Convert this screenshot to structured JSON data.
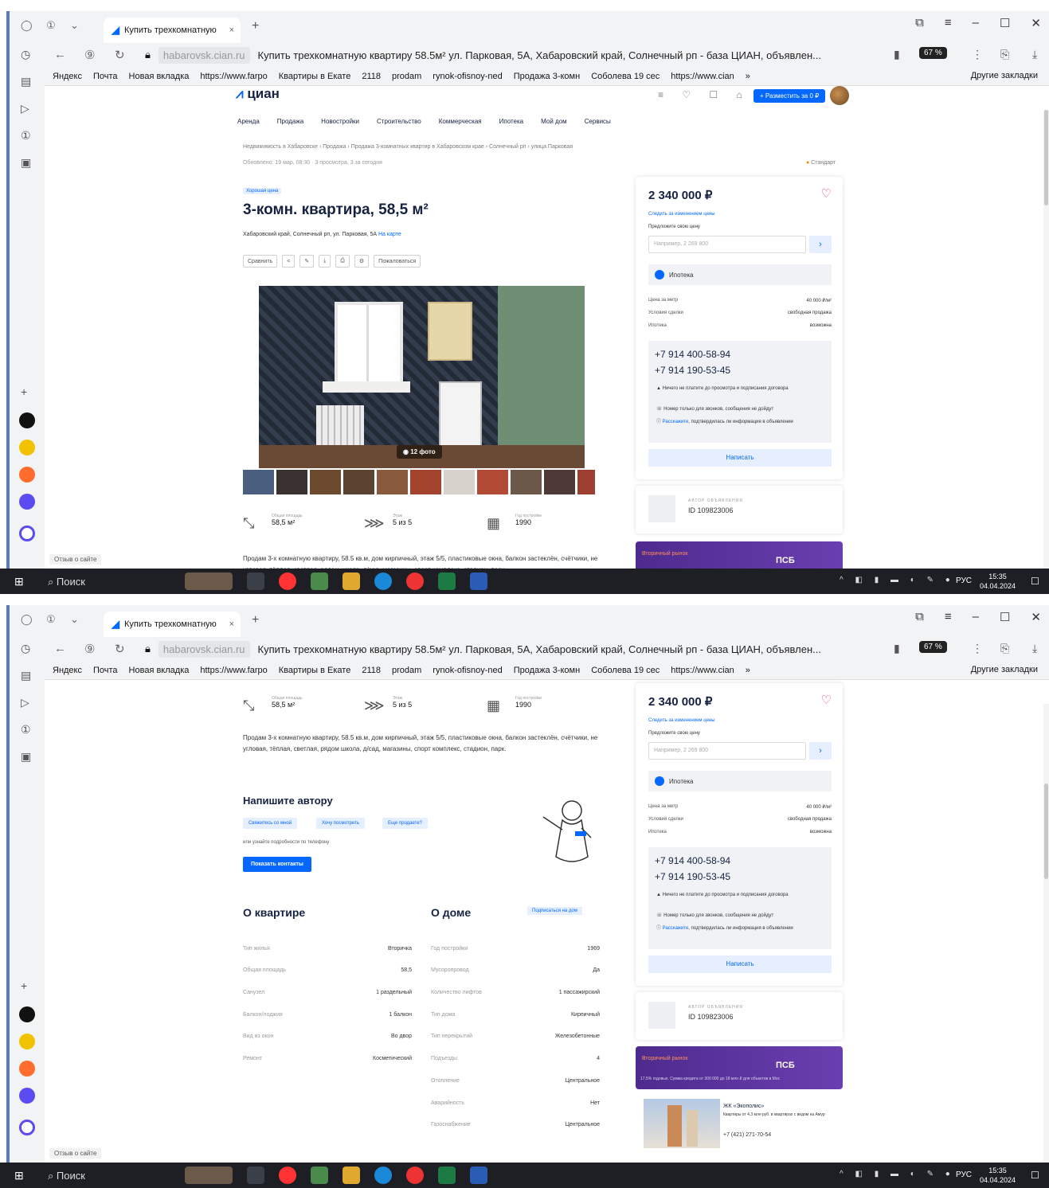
{
  "browser": {
    "tab_title": "Купить трехкомнатную",
    "tab_close": "×",
    "new_tab": "+",
    "domain": "habarovsk.cian.ru",
    "page_title": "Купить трехкомнатную квартиру 58.5м² ул. Парковая, 5А, Хабаровский край, Солнечный рп - база ЦИАН, объявлен...",
    "zoom": "67 %",
    "bookmarks": [
      "Яндекс",
      "Почта",
      "Новая вкладка",
      "https://www.farpo",
      "Квартиры в Екате",
      "2118",
      "prodam",
      "rynok-ofisnoy-ned",
      "Продажа 3-комн",
      "Соболева 19 cec",
      "https://www.cian"
    ],
    "bookmarks_more": "»",
    "other_bookmarks": "Другие закладки",
    "feedback": "Отзыв о сайте"
  },
  "site": {
    "logo": "циан",
    "post_button": "+ Разместить за 0 ₽",
    "nav": [
      "Аренда",
      "Продажа",
      "Новостройки",
      "Строительство",
      "Коммерческая",
      "Ипотека",
      "Мой дом",
      "Сервисы"
    ],
    "breadcrumbs": "Недвижимость в Хабаровске › Продажа › Продажа 3-комнатных квартир в Хабаровском крае › Солнечный рп › улица Парковая",
    "updated": "Обновлено: 19 мар, 08:30 · 3 просмотра, 3 за сегодня",
    "standard": "Стандарт"
  },
  "listing": {
    "price_tag": "Хорошая цена",
    "title": "3-комн. квартира, 58,5 м²",
    "address": "Хабаровский край, Солнечный рп, ул. Парковая, 5А",
    "map_link": "На карте",
    "toolbar": [
      "Сравнить",
      "<",
      "✎",
      "⤓",
      "⎙",
      "⚙",
      "Пожаловаться"
    ],
    "photo_count": "12 фото",
    "facts": [
      {
        "label": "Общая площадь",
        "value": "58,5 м²",
        "icon": "area-icon"
      },
      {
        "label": "Этаж",
        "value": "5 из 5",
        "icon": "stairs-icon"
      },
      {
        "label": "Год постройки",
        "value": "1990",
        "icon": "calendar-icon"
      }
    ],
    "description": "Продам 3-х комнатную квартиру, 58.5 кв.м, дом кирпичный, этаж 5/5, пластиковые окна, балкон застеклён, счётчики, не угловая, тёплая, светлая, рядом школа, д/сад, магазины, спорт комплекс, стадион, парк."
  },
  "sidebar_card": {
    "price": "2 340 000 ₽",
    "follow_price": "Следить за изменением цены",
    "offer_label": "Предложите свою цену",
    "offer_placeholder": "Например, 2 269 800",
    "offer_go": "›",
    "mortgage": "Ипотека",
    "rows": [
      {
        "k": "Цена за метр",
        "v": "40 000 ₽/м²"
      },
      {
        "k": "Условия сделки",
        "v": "свободная продажа"
      },
      {
        "k": "Ипотека",
        "v": "возможна"
      }
    ],
    "phone1": "+7 914 400-58-94",
    "phone2": "+7 914 190-53-45",
    "note1": "Ничего не платите до просмотра и подписания договора",
    "note2": "Номер только для звонков, сообщения не дойдут",
    "note3_link": "Расскажите",
    "note3": ", подтвердилась ли информация в объявлении",
    "write": "Написать",
    "author_label": "АВТОР ОБЪЯВЛЕНИЯ",
    "author_id": "ID 109823006",
    "banner_title": "Вторичный рынок",
    "banner_logo": "ПСБ",
    "banner_sub": "17,5% годовых. Сумма кредита от 300 000 до 18 млн ₽ для объектов в Мос"
  },
  "write_author": {
    "title": "Напишите автору",
    "chips": [
      "Свяжитесь со мной",
      "Хочу посмотреть",
      "Еще продаете?"
    ],
    "or_ask": "или узнайте подробности по телефону",
    "show_contacts": "Показать контакты"
  },
  "about_flat": {
    "title": "О квартире",
    "rows": [
      {
        "k": "Тип жилья",
        "v": "Вторичка"
      },
      {
        "k": "Общая площадь",
        "v": "58,5"
      },
      {
        "k": "Санузел",
        "v": "1 раздельный"
      },
      {
        "k": "Балкон/лоджия",
        "v": "1 балкон"
      },
      {
        "k": "Вид из окон",
        "v": "Во двор"
      },
      {
        "k": "Ремонт",
        "v": "Косметический"
      }
    ]
  },
  "about_house": {
    "title": "О доме",
    "subscribe": "Подписаться на дом",
    "rows": [
      {
        "k": "Год постройки",
        "v": "1969"
      },
      {
        "k": "Мусоропровод",
        "v": "Да"
      },
      {
        "k": "Количество лифтов",
        "v": "1 пассажирский"
      },
      {
        "k": "Тип дома",
        "v": "Кирпичный"
      },
      {
        "k": "Тип перекрытий",
        "v": "Железобетонные"
      },
      {
        "k": "Подъезды",
        "v": "4"
      },
      {
        "k": "Отопление",
        "v": "Центральное"
      },
      {
        "k": "Аварийность",
        "v": "Нет"
      },
      {
        "k": "Газоснабжение",
        "v": "Центральное"
      }
    ]
  },
  "jk_ad": {
    "title": "ЖК «Экополис»",
    "text": "Квартиры от 4,3 млн руб. в квартирах с видом на Амур",
    "phone": "+7 (421) 271-70-54"
  },
  "taskbar": {
    "search": "Поиск",
    "lang": "РУС",
    "time": "15:35",
    "date": "04.04.2024"
  }
}
